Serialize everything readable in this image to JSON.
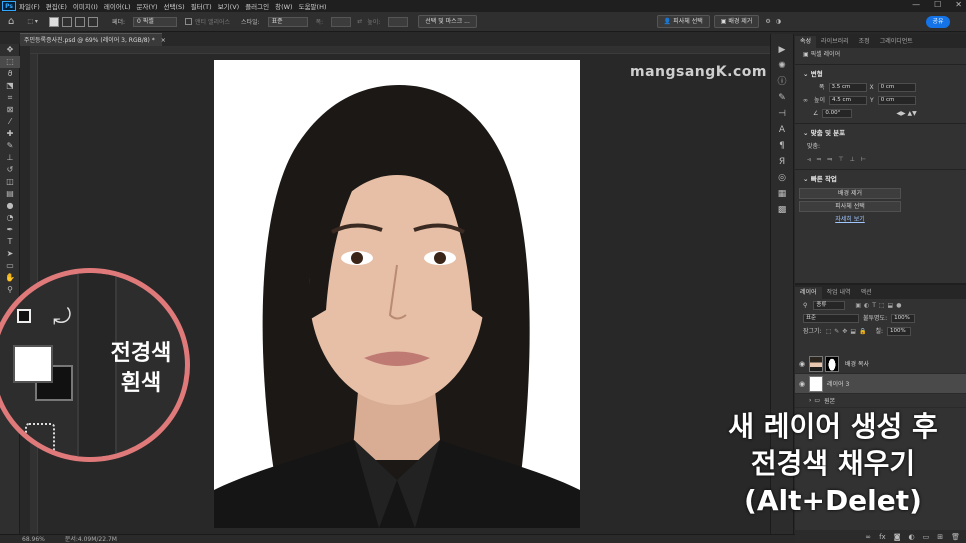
{
  "menubar": {
    "app_icon": "Ps",
    "items": [
      "파일(F)",
      "편집(E)",
      "이미지(I)",
      "레이어(L)",
      "문자(Y)",
      "선택(S)",
      "필터(T)",
      "보기(V)",
      "플러그인",
      "창(W)",
      "도움말(H)"
    ],
    "window_controls": [
      "—",
      "☐",
      "✕"
    ]
  },
  "options": {
    "feather_label": "페더:",
    "feather_value": "0 픽셀",
    "antialias": "앤티 앨리어스",
    "style_label": "스타일:",
    "style_value": "표준",
    "width_label": "폭:",
    "height_label": "높이:",
    "select_mask_button": "선택 및 마스크 ...",
    "subject_select_button": "피사체 선택",
    "remove_bg_button": "배경 제거",
    "share_button": "공유"
  },
  "document": {
    "tab_title": "주민등록증사진.psd @ 69% (레이어 3, RGB/8) *",
    "watermark": "mangsangK.com",
    "zoom": "68.96%",
    "doc_info": "문서:4.09M/22.7M"
  },
  "properties_panel": {
    "tabs": [
      "속성",
      "라이브러리",
      "조정",
      "그레이디언트"
    ],
    "active_tab": 0,
    "layer_type": "픽셀 레이어",
    "transform_title": "변형",
    "width_label": "폭",
    "width_value": "3.5 cm",
    "x_label": "X",
    "x_value": "0 cm",
    "height_label": "높이",
    "height_value": "4.5 cm",
    "y_label": "Y",
    "y_value": "0 cm",
    "angle_value": "0.00°",
    "align_title": "맞춤 및 분포",
    "align_label": "맞춤:",
    "quick_actions_title": "빠른 작업",
    "remove_bg_button": "배경 제거",
    "select_subject_button": "피사체 선택",
    "more_link": "자세히 보기"
  },
  "layers_panel": {
    "tabs": [
      "레이어",
      "작업 내역",
      "액션"
    ],
    "active_tab": 0,
    "filter_label": "종류",
    "blend_mode": "표준",
    "opacity_label": "불투명도:",
    "opacity_value": "100%",
    "lock_label": "잠그기:",
    "fill_label": "칠:",
    "fill_value": "100%",
    "layers": [
      {
        "name": "배경 복사",
        "visible": true,
        "selected": false,
        "kind": "photo-masked"
      },
      {
        "name": "레이어 3",
        "visible": true,
        "selected": true,
        "kind": "white"
      },
      {
        "name": "원본",
        "visible": false,
        "selected": false,
        "kind": "group"
      }
    ]
  },
  "callout": {
    "label_line1": "전경색",
    "label_line2": "흰색",
    "border_color": "#e07a7a"
  },
  "overlay": {
    "line1": "새 레이어 생성 후",
    "line2": "전경색 채우기",
    "line3": "(Alt+Delet)"
  },
  "colors": {
    "accent": "#1473e6",
    "foreground_swatch": "#ffffff",
    "background_swatch": "#111111"
  }
}
